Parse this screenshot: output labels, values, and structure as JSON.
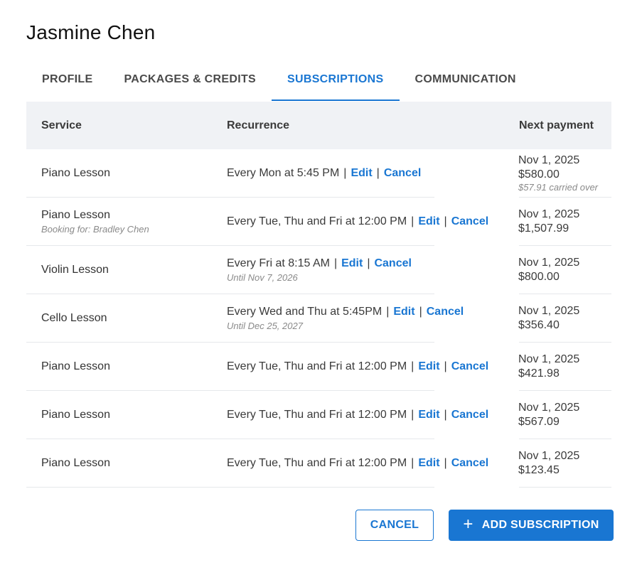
{
  "customer": {
    "name": "Jasmine Chen"
  },
  "tabs": [
    {
      "label": "PROFILE",
      "active": false
    },
    {
      "label": "PACKAGES & CREDITS",
      "active": false
    },
    {
      "label": "SUBSCRIPTIONS",
      "active": true
    },
    {
      "label": "COMMUNICATION",
      "active": false
    }
  ],
  "table": {
    "headers": {
      "service": "Service",
      "recurrence": "Recurrence",
      "next_payment": "Next payment"
    },
    "rows": [
      {
        "service": "Piano Lesson",
        "booking_for": "",
        "recurrence": "Every Mon at 5:45 PM",
        "until": "",
        "edit_label": "Edit",
        "cancel_label": "Cancel",
        "next_date": "Nov 1, 2025",
        "amount": "$580.00",
        "carried_over": "$57.91 carried over"
      },
      {
        "service": "Piano Lesson",
        "booking_for": "Booking for: Bradley Chen",
        "recurrence": "Every Tue, Thu and Fri at 12:00 PM",
        "until": "",
        "edit_label": "Edit",
        "cancel_label": "Cancel",
        "next_date": "Nov 1, 2025",
        "amount": "$1,507.99",
        "carried_over": ""
      },
      {
        "service": "Violin Lesson",
        "booking_for": "",
        "recurrence": "Every Fri at 8:15 AM",
        "until": "Until Nov 7, 2026",
        "edit_label": "Edit",
        "cancel_label": "Cancel",
        "next_date": "Nov 1, 2025",
        "amount": "$800.00",
        "carried_over": ""
      },
      {
        "service": "Cello Lesson",
        "booking_for": "",
        "recurrence": "Every Wed and Thu at 5:45PM",
        "until": "Until Dec 25, 2027",
        "edit_label": "Edit",
        "cancel_label": "Cancel",
        "next_date": "Nov 1, 2025",
        "amount": "$356.40",
        "carried_over": ""
      },
      {
        "service": "Piano Lesson",
        "booking_for": "",
        "recurrence": "Every Tue, Thu and Fri at 12:00 PM",
        "until": "",
        "edit_label": "Edit",
        "cancel_label": "Cancel",
        "next_date": "Nov 1, 2025",
        "amount": "$421.98",
        "carried_over": ""
      },
      {
        "service": "Piano Lesson",
        "booking_for": "",
        "recurrence": "Every Tue, Thu and Fri at 12:00 PM",
        "until": "",
        "edit_label": "Edit",
        "cancel_label": "Cancel",
        "next_date": "Nov 1, 2025",
        "amount": "$567.09",
        "carried_over": ""
      },
      {
        "service": "Piano Lesson",
        "booking_for": "",
        "recurrence": "Every Tue, Thu and Fri at 12:00 PM",
        "until": "",
        "edit_label": "Edit",
        "cancel_label": "Cancel",
        "next_date": "Nov 1, 2025",
        "amount": "$123.45",
        "carried_over": ""
      }
    ]
  },
  "actions": {
    "cancel_label": "CANCEL",
    "add_label": "ADD SUBSCRIPTION",
    "add_icon": "plus-icon"
  },
  "colors": {
    "accent": "#1976d2",
    "header_bg": "#f0f2f5"
  }
}
